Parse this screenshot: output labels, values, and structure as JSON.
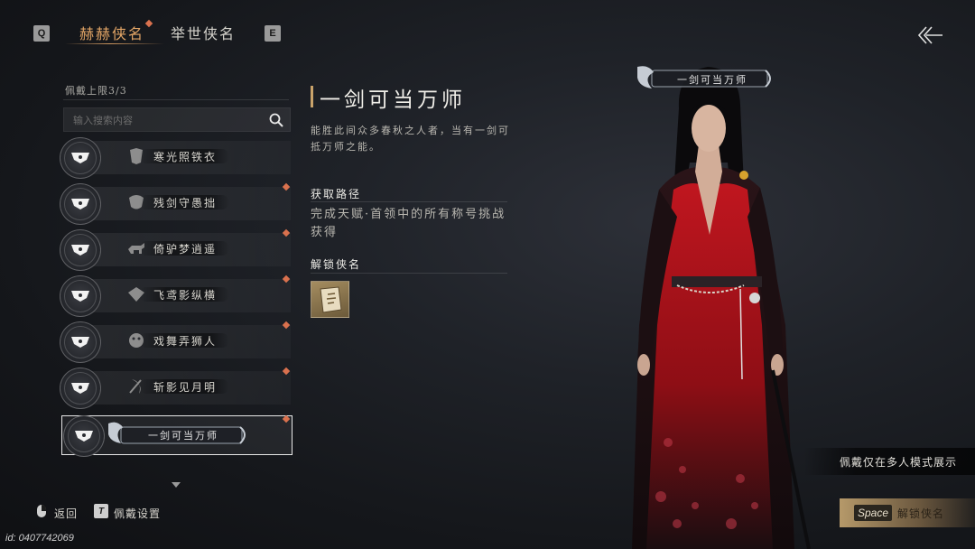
{
  "tabs": {
    "prev_key": "Q",
    "next_key": "E",
    "items": [
      {
        "label": "赫赫侠名"
      },
      {
        "label": "举世侠名"
      }
    ]
  },
  "list": {
    "limit_text": "佩戴上限3/3",
    "search_placeholder": "输入搜索内容",
    "items": [
      {
        "label": "寒光照铁衣"
      },
      {
        "label": "残剑守愚拙"
      },
      {
        "label": "倚驴梦逍遥"
      },
      {
        "label": "飞鸢影纵横"
      },
      {
        "label": "戏舞弄狮人"
      },
      {
        "label": "斩影见月明"
      },
      {
        "label": "一剑可当万师"
      }
    ],
    "selected_index": 6
  },
  "detail": {
    "title": "一剑可当万师",
    "description": "能胜此间众多春秋之人者，当有一剑可抵万师之能。",
    "source_heading": "获取路径",
    "source_text": "完成天赋·首领中的所有称号挑战获得",
    "unlock_heading": "解锁侠名"
  },
  "character": {
    "name_plate": "一剑可当万师",
    "colors": {
      "robe": "#b3141c",
      "dark": "#1a0d10"
    }
  },
  "hint": "佩戴仅在多人模式展示",
  "action": {
    "key": "Space",
    "label": "解锁侠名"
  },
  "footer": {
    "back_label": "返回",
    "settings_key": "T",
    "settings_label": "佩戴设置",
    "uid": "id: 0407742069"
  },
  "colors": {
    "accent": "#e2a566",
    "dot": "#d9714e"
  }
}
